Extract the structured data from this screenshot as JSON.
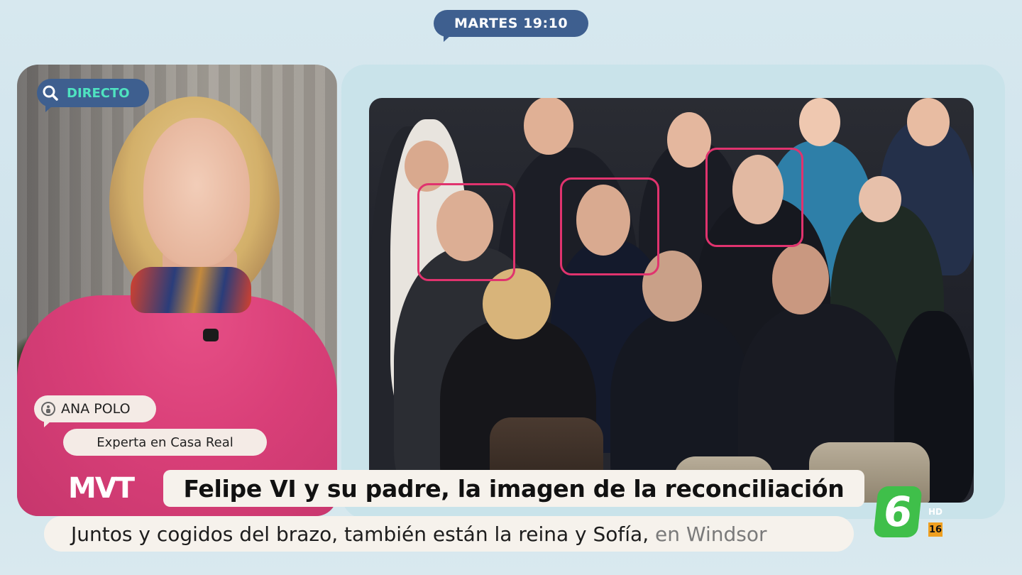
{
  "header": {
    "time": "MARTES 19:10"
  },
  "presenter": {
    "live_label": "DIRECTO",
    "name": "ANA POLO",
    "role": "Experta en Casa Real"
  },
  "photo": {
    "highlight_color": "#e0336e",
    "highlighted_people": 3
  },
  "lower_third": {
    "logo": "MVT",
    "headline": "Felipe VI y su padre, la imagen de la reconciliación",
    "subtitle_main": "Juntos y cogidos del brazo, también están la reina y Sofía,",
    "subtitle_fade": "en Windsor"
  },
  "channel": {
    "logo": "6",
    "hd_label": "HD",
    "age_rating": "16",
    "brand_color": "#3fbf4a"
  },
  "colors": {
    "pill_blue": "#3e5f8f",
    "live_green": "#4fe3c0",
    "tag_bg": "#f4ebe6"
  }
}
